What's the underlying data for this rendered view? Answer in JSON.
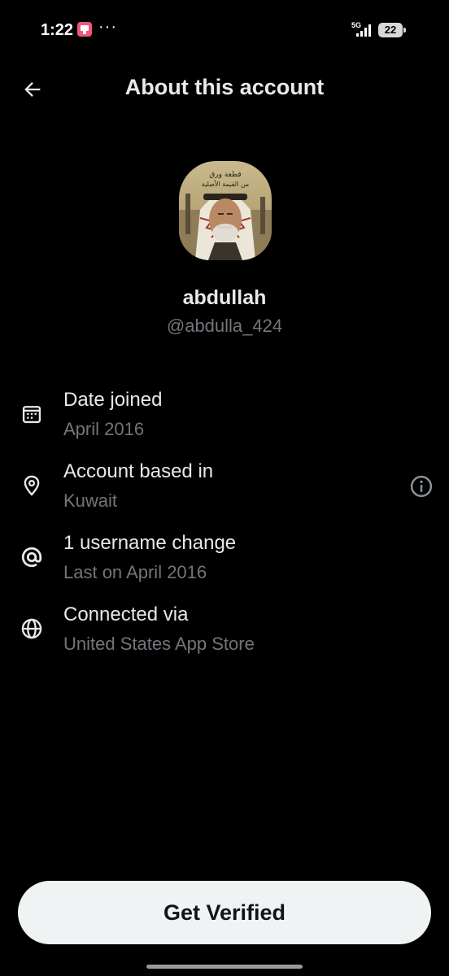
{
  "status_bar": {
    "time": "1:22",
    "more": "···",
    "network": "5G",
    "battery": "22"
  },
  "header": {
    "title": "About this account"
  },
  "profile": {
    "display_name": "abdullah",
    "handle": "@abdulla_424",
    "avatar_caption_lines": [
      "قطعة ورق",
      "من القيمة الأصلية"
    ]
  },
  "info": {
    "rows": [
      {
        "icon": "calendar-icon",
        "label": "Date joined",
        "value": "April 2016"
      },
      {
        "icon": "location-pin-icon",
        "label": "Account based in",
        "value": "Kuwait"
      },
      {
        "icon": "at-sign-icon",
        "label": "1 username change",
        "value": "Last on April 2016"
      },
      {
        "icon": "globe-icon",
        "label": "Connected via",
        "value": "United States App Store"
      }
    ]
  },
  "footer": {
    "verify_label": "Get Verified"
  },
  "colors": {
    "background": "#000000",
    "primary_text": "#e7e9ea",
    "secondary_text": "#71767b",
    "button_bg": "#eff3f4",
    "button_text": "#0f1419"
  }
}
